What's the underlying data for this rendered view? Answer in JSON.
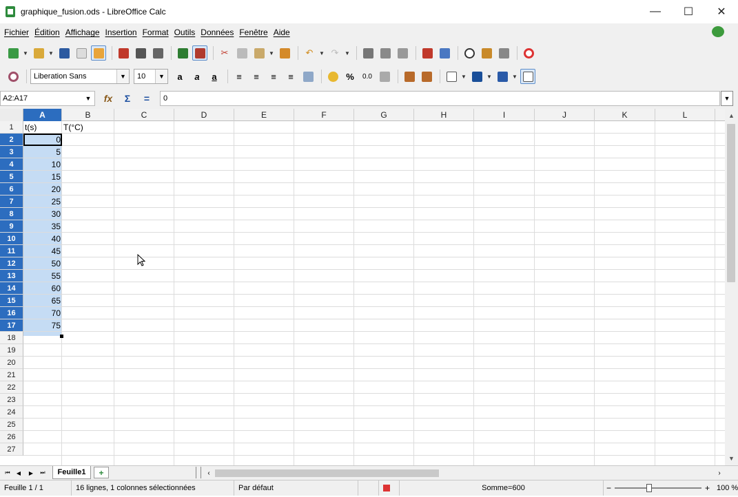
{
  "window": {
    "title": "graphique_fusion.ods - LibreOffice Calc",
    "minimize": "—",
    "maximize": "☐",
    "close": "✕"
  },
  "menu": {
    "items": [
      "Fichier",
      "Édition",
      "Affichage",
      "Insertion",
      "Format",
      "Outils",
      "Données",
      "Fenêtre",
      "Aide"
    ]
  },
  "toolbar": {
    "font_name": "Liberation Sans",
    "font_size": "10"
  },
  "formula_bar": {
    "name_box": "A2:A17",
    "content": "0",
    "sum_symbol": "Σ",
    "equals_symbol": "="
  },
  "sheet": {
    "columns": [
      "A",
      "B",
      "C",
      "D",
      "E",
      "F",
      "G",
      "H",
      "I",
      "J",
      "K",
      "L"
    ],
    "selected_column": "A",
    "rows": [
      "1",
      "2",
      "3",
      "4",
      "5",
      "6",
      "7",
      "8",
      "9",
      "10",
      "11",
      "12",
      "13",
      "14",
      "15",
      "16",
      "17",
      "18",
      "19",
      "20",
      "21",
      "22",
      "23",
      "24",
      "25",
      "26",
      "27"
    ],
    "header_a1": "t(s)",
    "header_b1": "T(°C)",
    "column_a_values": [
      "0",
      "5",
      "10",
      "15",
      "20",
      "25",
      "30",
      "35",
      "40",
      "45",
      "50",
      "55",
      "60",
      "65",
      "70",
      "75"
    ]
  },
  "tabs": {
    "active_sheet": "Feuille1",
    "add_label": "+"
  },
  "status": {
    "sheet_position": "Feuille 1 / 1",
    "selection_info": "16 lignes, 1 colonnes sélectionnées",
    "page_style": "Par défaut",
    "sum": "Somme=600",
    "zoom": "100 %"
  }
}
